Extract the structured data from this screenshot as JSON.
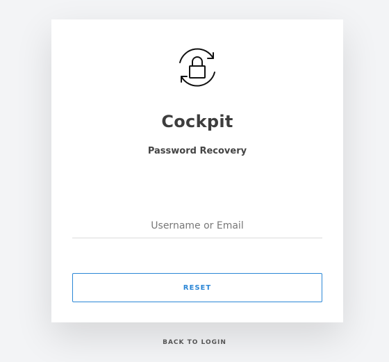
{
  "app": {
    "name": "Cockpit",
    "subtitle": "Password Recovery"
  },
  "form": {
    "username_placeholder": "Username or Email",
    "username_value": "",
    "reset_label": "RESET"
  },
  "footer": {
    "back_label": "BACK TO LOGIN"
  },
  "colors": {
    "accent": "#2a86d6",
    "background": "#f3f4f6",
    "card": "#ffffff",
    "text": "#3d3d3d"
  },
  "icons": {
    "logo": "lock-refresh-icon"
  }
}
